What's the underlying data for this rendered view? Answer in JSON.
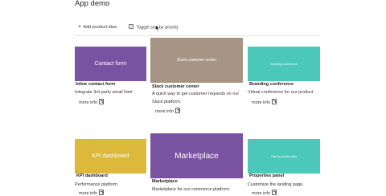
{
  "app": {
    "title": "App demo"
  },
  "toolbar": {
    "add_label": "Add product idea",
    "toggle_label": "Toggel sort by priority"
  },
  "icons": {
    "add": "plus-icon",
    "toggle": "checkbox-icon",
    "link": "external-link-icon",
    "pointer": "mouse-cursor-icon"
  },
  "colors": {
    "purple": "#7a52a2",
    "taupe": "#a69584",
    "teal": "#4bc8b9",
    "mustard": "#dcb83b"
  },
  "cards": [
    {
      "thumb_text": "Contact form",
      "title": "Inline contact form",
      "desc": "Integrate 3rd party email html",
      "link": "more info"
    },
    {
      "thumb_text": "Slack customer center",
      "title": "Slack customer center",
      "desc": "A quick way to get customer requests on our Slack platform.",
      "link": "more info"
    },
    {
      "thumb_text": "Branding conference",
      "title": "Branding conference",
      "desc": "Virtual conference for our product",
      "link": "more info"
    },
    {
      "thumb_text": "KPI dashboard",
      "title": "KPI dashboard",
      "desc": "Performance platform",
      "link": "more info"
    },
    {
      "thumb_text": "Marketplace",
      "title": "Marketplace",
      "desc": "Marketplace for our commerce platform.",
      "link": "more info"
    },
    {
      "thumb_text": "Filter by priority strike",
      "title": "Properties panel",
      "desc": "Customize the landing page.",
      "link": "more info"
    }
  ]
}
